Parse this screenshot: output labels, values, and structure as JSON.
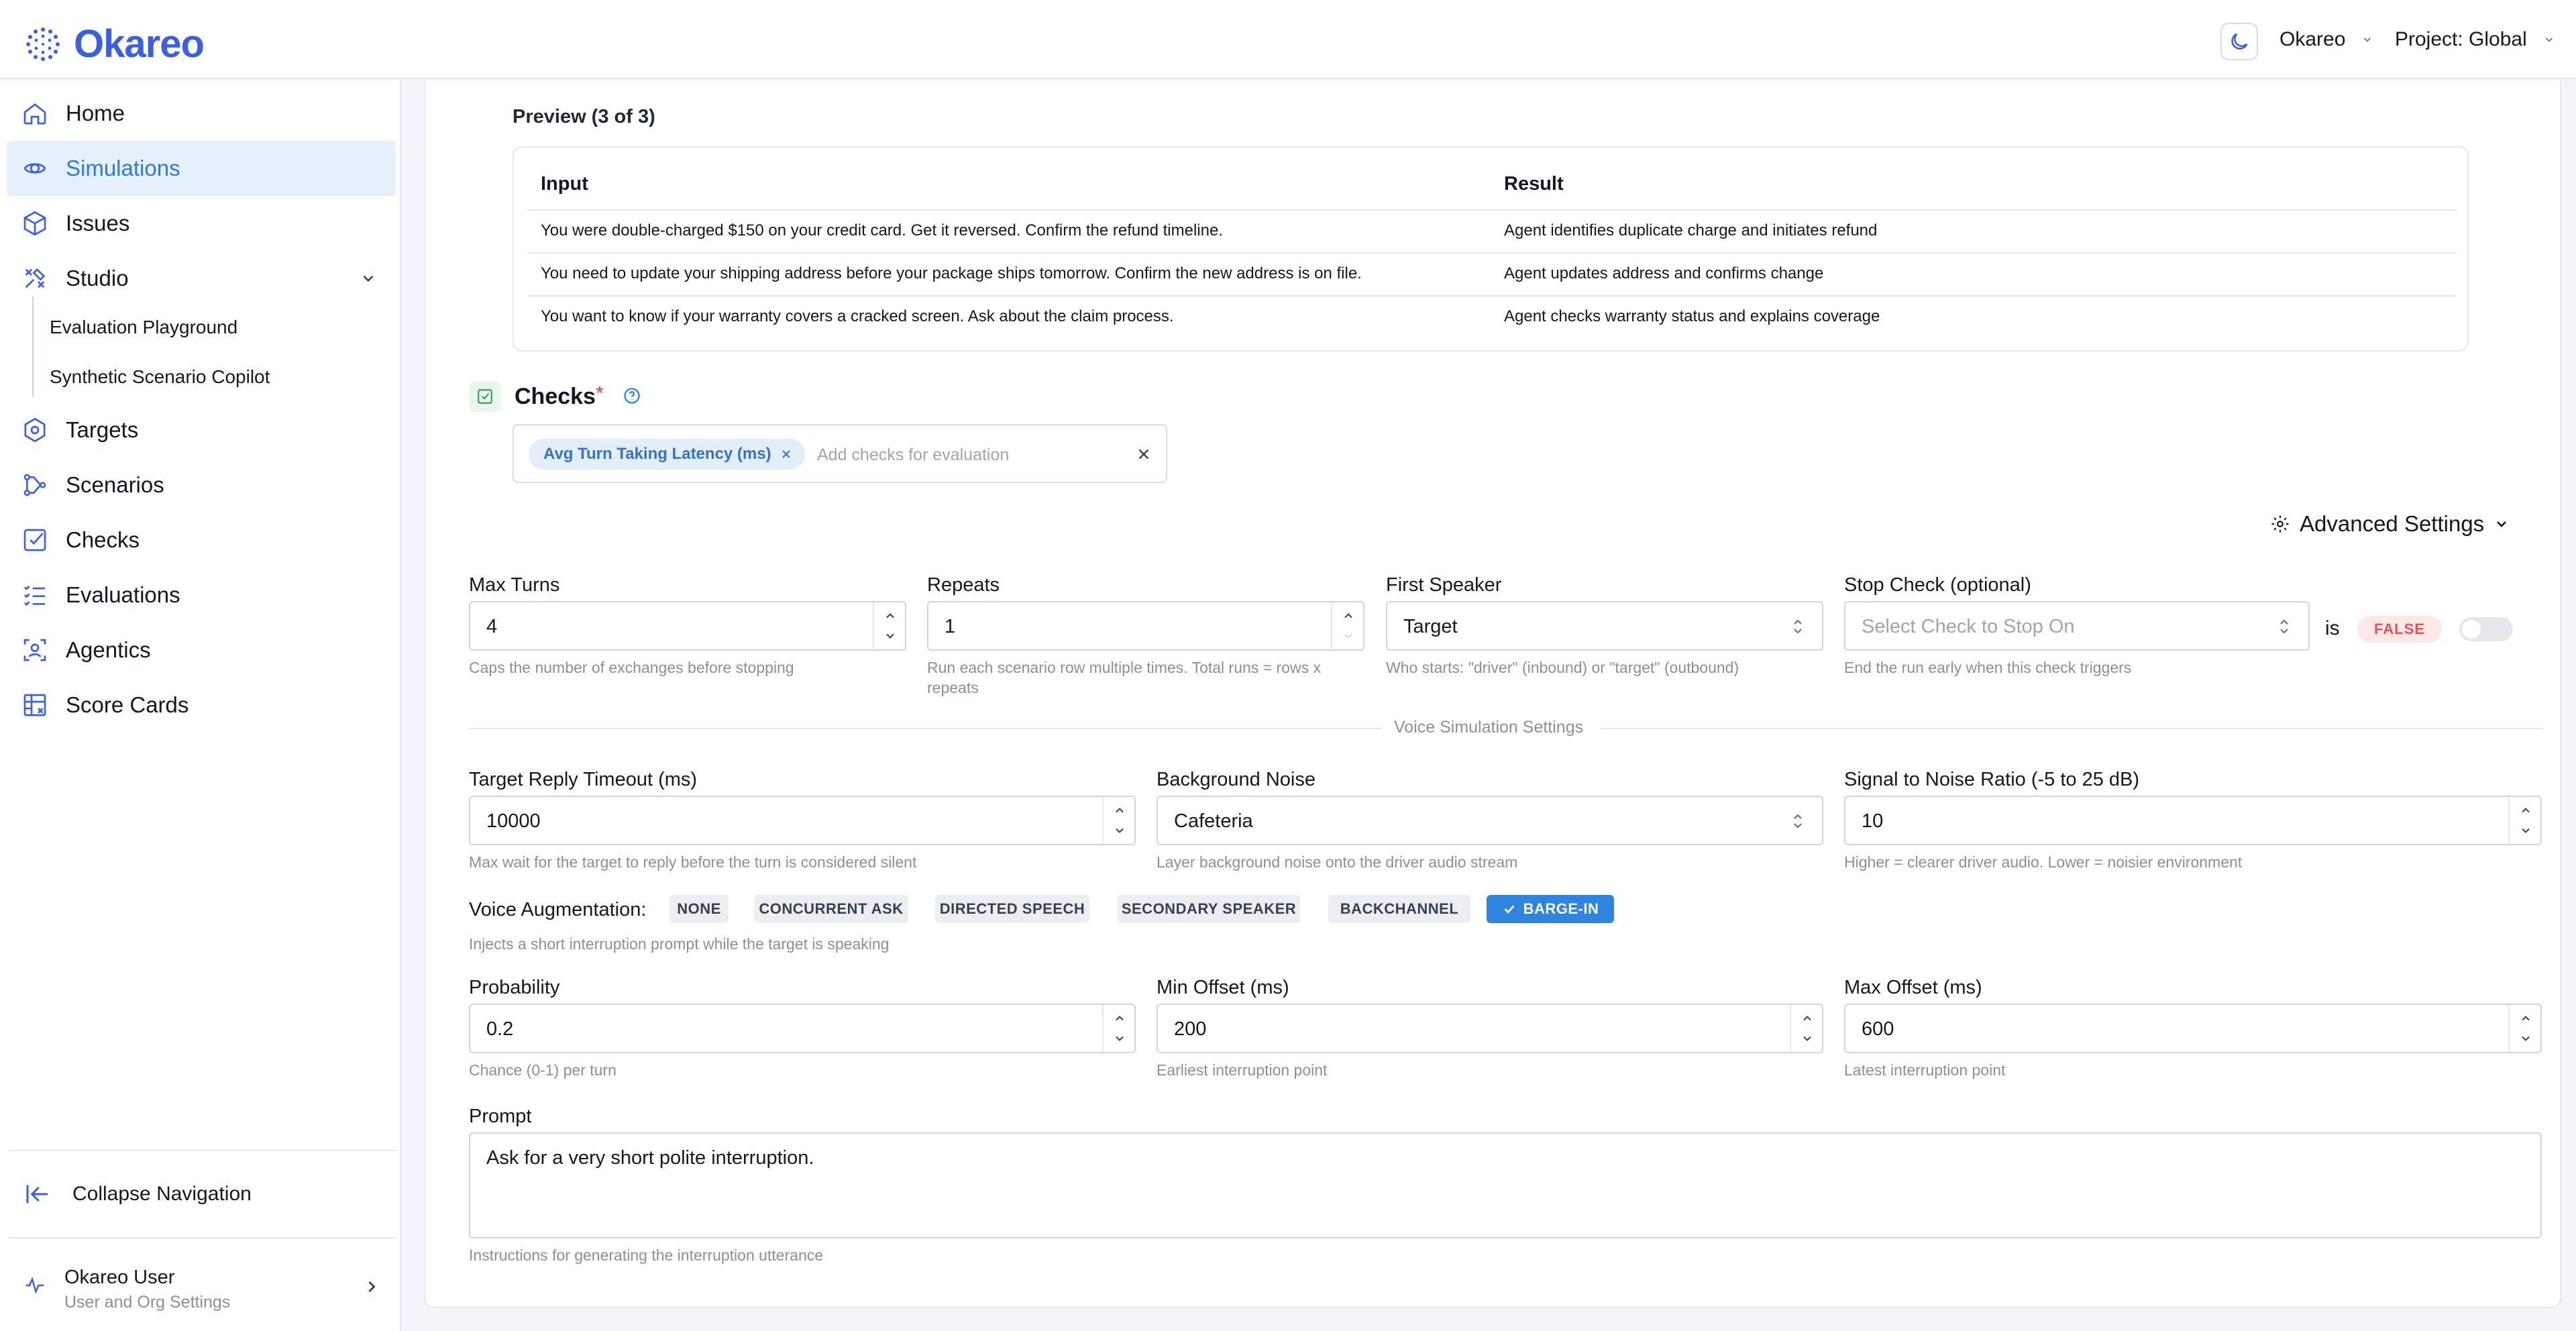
{
  "header": {
    "logo": "Okareo",
    "org": "Okareo",
    "project": "Project: Global"
  },
  "sidebar": {
    "items": [
      {
        "label": "Home",
        "icon": "home-icon"
      },
      {
        "label": "Simulations",
        "icon": "simulations-icon",
        "active": true
      },
      {
        "label": "Issues",
        "icon": "cube-icon"
      },
      {
        "label": "Studio",
        "icon": "studio-icon"
      },
      {
        "label": "Targets",
        "icon": "hexagon-icon"
      },
      {
        "label": "Scenarios",
        "icon": "scenarios-icon"
      },
      {
        "label": "Checks",
        "icon": "checkbox-icon"
      },
      {
        "label": "Evaluations",
        "icon": "list-icon"
      },
      {
        "label": "Agentics",
        "icon": "agentics-icon"
      },
      {
        "label": "Score Cards",
        "icon": "table-icon"
      }
    ],
    "studio_sub": [
      "Evaluation Playground",
      "Synthetic Scenario Copilot"
    ],
    "collapse": "Collapse Navigation",
    "user_name": "Okareo User",
    "user_sub": "User and Org Settings"
  },
  "preview": {
    "title": "Preview (3 of 3)",
    "columns": [
      "Input",
      "Result"
    ],
    "rows": [
      {
        "input": "You were double-charged $150 on your credit card. Get it reversed. Confirm the refund timeline.",
        "result": "Agent identifies duplicate charge and initiates refund"
      },
      {
        "input": "You need to update your shipping address before your package ships tomorrow. Confirm the new address is on file.",
        "result": "Agent updates address and confirms change"
      },
      {
        "input": "You want to know if your warranty covers a cracked screen. Ask about the claim process.",
        "result": "Agent checks warranty status and explains coverage"
      }
    ]
  },
  "checks": {
    "title": "Checks",
    "required": "*",
    "chip": "Avg Turn Taking Latency (ms)",
    "placeholder": "Add checks for evaluation"
  },
  "advanced": {
    "label": "Advanced Settings"
  },
  "fields": {
    "max_turns": {
      "label": "Max Turns",
      "value": "4",
      "help": "Caps the number of exchanges before stopping"
    },
    "repeats": {
      "label": "Repeats",
      "value": "1",
      "help1": "Run each scenario row multiple times. Total runs = rows x",
      "help2": "repeats"
    },
    "first_speaker": {
      "label": "First Speaker",
      "value": "Target",
      "help": "Who starts: \"driver\" (inbound) or \"target\" (outbound)"
    },
    "stop_check": {
      "label": "Stop Check (optional)",
      "placeholder": "Select Check to Stop On",
      "is": "is",
      "badge": "FALSE",
      "help": "End the run early when this check triggers"
    },
    "section": "Voice Simulation Settings",
    "timeout": {
      "label": "Target Reply Timeout (ms)",
      "value": "10000",
      "help": "Max wait for the target to reply before the turn is considered silent"
    },
    "noise": {
      "label": "Background Noise",
      "value": "Cafeteria",
      "help": "Layer background noise onto the driver audio stream"
    },
    "snr": {
      "label": "Signal to Noise Ratio (-5 to 25 dB)",
      "value": "10",
      "help": "Higher = clearer driver audio. Lower = noisier environment"
    },
    "augmentation": {
      "label": "Voice Augmentation:",
      "options": [
        "NONE",
        "CONCURRENT ASK",
        "DIRECTED SPEECH",
        "SECONDARY SPEAKER",
        "BACKCHANNEL",
        "BARGE-IN"
      ],
      "selected": "BARGE-IN",
      "help": "Injects a short interruption prompt while the target is speaking"
    },
    "probability": {
      "label": "Probability",
      "value": "0.2",
      "help": "Chance (0-1) per turn"
    },
    "min_offset": {
      "label": "Min Offset (ms)",
      "value": "200",
      "help": "Earliest interruption point"
    },
    "max_offset": {
      "label": "Max Offset (ms)",
      "value": "600",
      "help": "Latest interruption point"
    },
    "prompt": {
      "label": "Prompt",
      "value": "Ask for a very short polite interruption.",
      "help": "Instructions for generating the interruption utterance"
    }
  },
  "colors": {
    "brand": "#3b5fe0",
    "accent": "#2f84e0",
    "active_bg": "#e6f0fb",
    "danger": "#e25555"
  }
}
